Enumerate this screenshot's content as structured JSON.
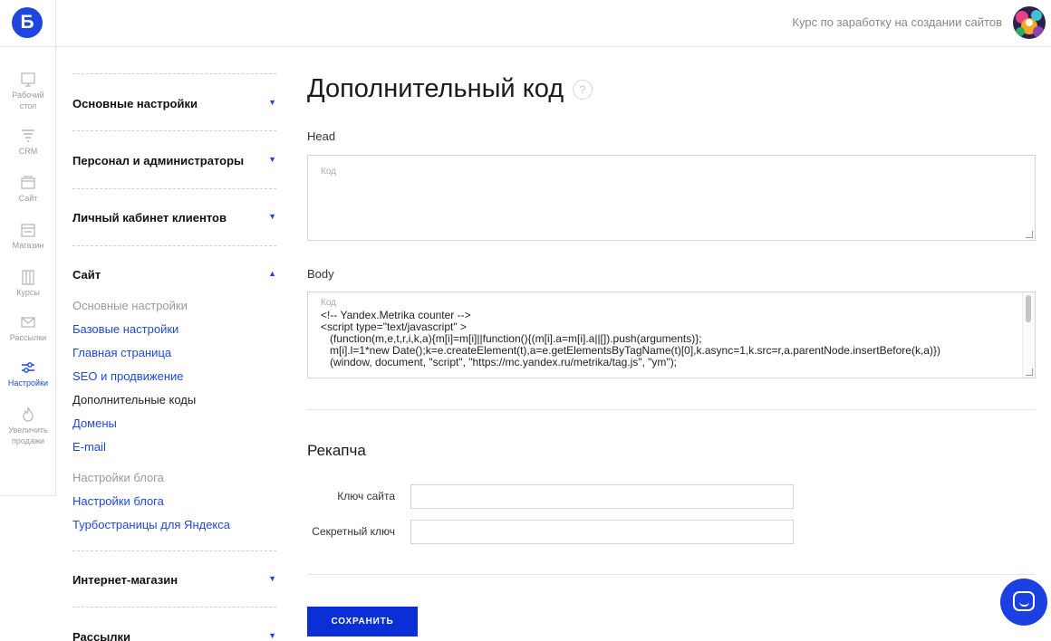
{
  "topbar": {
    "logo_letter": "Б",
    "course_text": "Курс по заработку на создании сайтов"
  },
  "rail": [
    {
      "label_line1": "Рабочий",
      "label_line2": "стол",
      "icon": "desktop-icon"
    },
    {
      "label_line1": "CRM",
      "label_line2": "",
      "icon": "funnel-icon"
    },
    {
      "label_line1": "Сайт",
      "label_line2": "",
      "icon": "site-icon"
    },
    {
      "label_line1": "Магазин",
      "label_line2": "",
      "icon": "shop-icon"
    },
    {
      "label_line1": "Курсы",
      "label_line2": "",
      "icon": "courses-icon"
    },
    {
      "label_line1": "Рассылки",
      "label_line2": "",
      "icon": "mail-icon"
    },
    {
      "label_line1": "Настройки",
      "label_line2": "",
      "icon": "settings-sliders-icon",
      "active": true
    },
    {
      "label_line1": "Увеличить",
      "label_line2": "продажи",
      "icon": "fire-icon"
    }
  ],
  "nav": {
    "sections": [
      {
        "label": "Основные настройки",
        "arrow": "▼"
      },
      {
        "label": "Персонал и администраторы",
        "arrow": "▼"
      },
      {
        "label": "Личный кабинет клиентов",
        "arrow": "▼"
      },
      {
        "label": "Сайт",
        "arrow": "▲"
      },
      {
        "label": "Интернет-магазин",
        "arrow": "▼"
      },
      {
        "label": "Рассылки",
        "arrow": "▼"
      }
    ],
    "site_group1_title": "Основные настройки",
    "site_group1_items": [
      "Базовые настройки",
      "Главная страница",
      "SEO и продвижение",
      "Дополнительные коды",
      "Домены",
      "E-mail"
    ],
    "site_group2_title": "Настройки блога",
    "site_group2_items": [
      "Настройки блога",
      "Турбостраницы для Яндекса"
    ]
  },
  "main": {
    "title": "Дополнительный код",
    "help": "?",
    "head_label": "Head",
    "head_placeholder": "Код",
    "body_label": "Body",
    "body_placeholder": "Код",
    "body_code": "<!-- Yandex.Metrika counter -->\n<script type=\"text/javascript\" >\n   (function(m,e,t,r,i,k,a){m[i]=m[i]||function(){(m[i].a=m[i].a||[]).push(arguments)};\n   m[i].l=1*new Date();k=e.createElement(t),a=e.getElementsByTagName(t)[0],k.async=1,k.src=r,a.parentNode.insertBefore(k,a)})\n   (window, document, \"script\", \"https://mc.yandex.ru/metrika/tag.js\", \"ym\");",
    "captcha_title": "Рекапча",
    "site_key_label": "Ключ сайта",
    "secret_key_label": "Секретный ключ",
    "save_label": "СОХРАНИТЬ"
  },
  "colors": {
    "accent": "#1f47e0",
    "button": "#0a2fd6"
  }
}
